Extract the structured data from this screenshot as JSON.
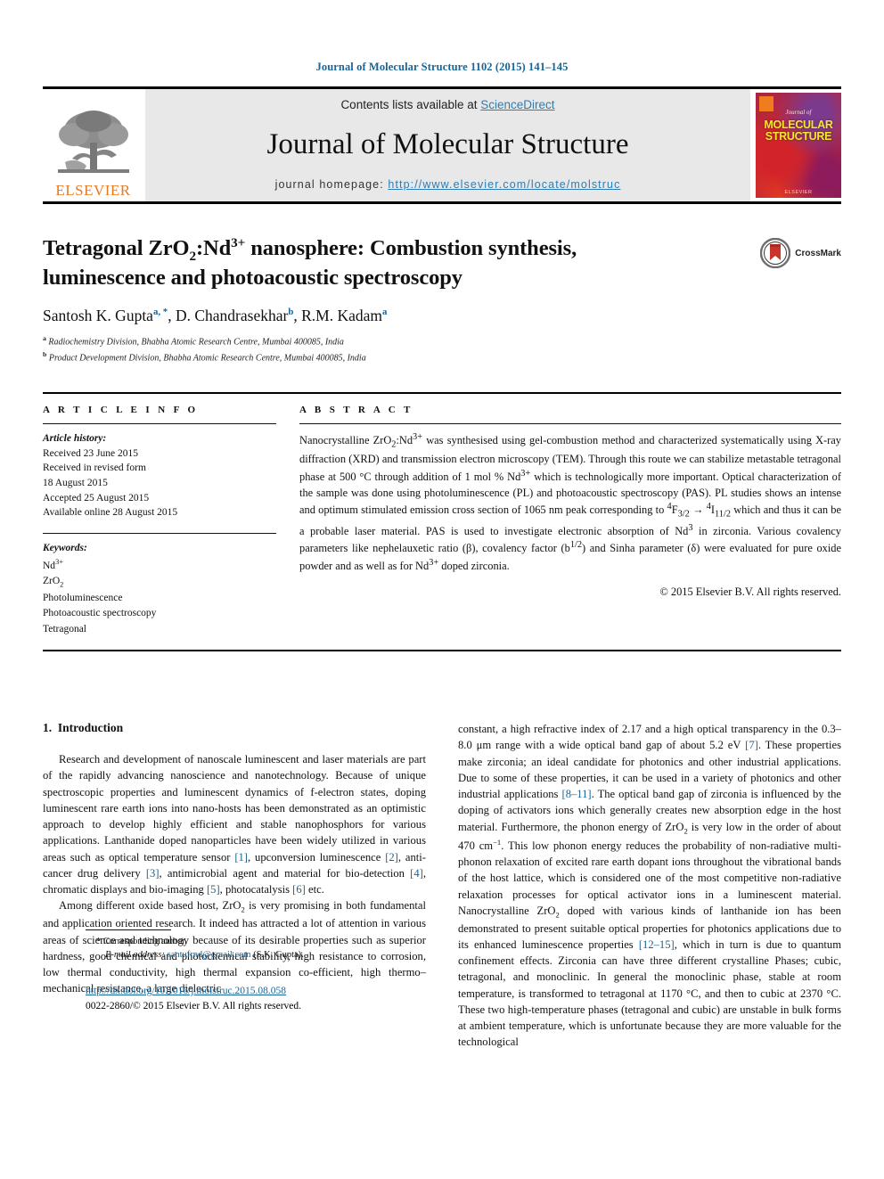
{
  "running_head": "Journal of Molecular Structure 1102 (2015) 141–145",
  "masthead": {
    "contents_prefix": "Contents lists available at ",
    "sciencedirect": "ScienceDirect",
    "journal_name": "Journal of Molecular Structure",
    "homepage_label": "journal homepage: ",
    "homepage_url": "http://www.elsevier.com/locate/molstruc",
    "publisher_wordmark": "ELSEVIER",
    "cover": {
      "kicker": "Journal of",
      "line1": "MOLECULAR",
      "line2": "STRUCTURE",
      "publisher": "ELSEVIER"
    },
    "colors": {
      "link": "#2E7DB3",
      "elsevier_orange": "#E87B1E",
      "band_background": "#e8e8e8"
    }
  },
  "article": {
    "title_line1_pre": "Tetragonal ZrO",
    "title_sub": "2",
    "title_line1_mid": ":Nd",
    "title_sup": "3+",
    "title_line1_post": " nanosphere: Combustion synthesis,",
    "title_line2": "luminescence and photoacoustic spectroscopy",
    "crossmark_label": "CrossMark",
    "authors_html": "Santosh K. Gupta, D. Chandrasekhar, R.M. Kadam",
    "affiliation_a": "Radiochemistry Division, Bhabha Atomic Research Centre, Mumbai 400085, India",
    "affiliation_b": "Product Development Division, Bhabha Atomic Research Centre, Mumbai 400085, India"
  },
  "article_info": {
    "heading": "A R T I C L E  I N F O",
    "history_label": "Article history:",
    "history": [
      "Received 23 June 2015",
      "Received in revised form",
      "18 August 2015",
      "Accepted 25 August 2015",
      "Available online 28 August 2015"
    ],
    "keywords_label": "Keywords:",
    "keywords": [
      "Nd3+",
      "ZrO2",
      "Photoluminescence",
      "Photoacoustic spectroscopy",
      "Tetragonal"
    ]
  },
  "abstract": {
    "heading": "A B S T R A C T",
    "body": "Nanocrystalline ZrO2:Nd3+ was synthesised using gel-combustion method and characterized systematically using X-ray diffraction (XRD) and transmission electron microscopy (TEM). Through this route we can stabilize metastable tetragonal phase at 500 °C through addition of 1 mol % Nd3+ which is technologically more important. Optical characterization of the sample was done using photoluminescence (PL) and photoacoustic spectroscopy (PAS). PL studies shows an intense and optimum stimulated emission cross section of 1065 nm peak corresponding to 4F3/2 → 4I11/2 which and thus it can be a probable laser material. PAS is used to investigate electronic absorption of Nd3 in zirconia. Various covalency parameters like nephelauxetic ratio (β), covalency factor (b1/2) and Sinha parameter (δ) were evaluated for pure oxide powder and as well as for Nd3+ doped zirconia.",
    "copyright": "© 2015 Elsevier B.V. All rights reserved."
  },
  "introduction": {
    "section_number": "1.",
    "section_title": "Introduction",
    "left_paragraphs": [
      "Research and development of nanoscale luminescent and laser materials are part of the rapidly advancing nanoscience and nanotechnology. Because of unique spectroscopic properties and luminescent dynamics of f-electron states, doping luminescent rare earth ions into nano-hosts has been demonstrated as an optimistic approach to develop highly efficient and stable nanophosphors for various applications. Lanthanide doped nanoparticles have been widely utilized in various areas such as optical temperature sensor [1], upconversion luminescence [2], anti-cancer drug delivery [3], antimicrobial agent and material for bio-detection [4], chromatic displays and bio-imaging [5], photocatalysis [6] etc.",
      "Among different oxide based host, ZrO2 is very promising in both fundamental and application oriented research. It indeed has attracted a lot of attention in various areas of science and technology because of its desirable properties such as superior hardness, good chemical and photochemical stability, high resistance to corrosion, low thermal conductivity, high thermal expansion co-efficient, high thermo–mechanical resistance, a large dielectric"
    ],
    "right_paragraphs": [
      "constant, a high refractive index of 2.17 and a high optical transparency in the 0.3–8.0 μm range with a wide optical band gap of about 5.2 eV [7]. These properties make zirconia; an ideal candidate for photonics and other industrial applications. Due to some of these properties, it can be used in a variety of photonics and other industrial applications [8–11]. The optical band gap of zirconia is influenced by the doping of activators ions which generally creates new absorption edge in the host material. Furthermore, the phonon energy of ZrO2 is very low in the order of about 470 cm−1. This low phonon energy reduces the probability of non-radiative multi-phonon relaxation of excited rare earth dopant ions throughout the vibrational bands of the host lattice, which is considered one of the most competitive non-radiative relaxation processes for optical activator ions in a luminescent material. Nanocrystalline ZrO2 doped with various kinds of lanthanide ion has been demonstrated to present suitable optical properties for photonics applications due to its enhanced luminescence properties [12–15], which in turn is due to quantum confinement effects. Zirconia can have three different crystalline Phases; cubic, tetragonal, and monoclinic. In general the monoclinic phase, stable at room temperature, is transformed to tetragonal at 1170 °C, and then to cubic at 2370 °C. These two high-temperature phases (tetragonal and cubic) are unstable in bulk forms at ambient temperature, which is unfortunate because they are more valuable for the technological"
    ]
  },
  "footnotes": {
    "corresponding_marker": "*",
    "corresponding_text": "Corresponding author.",
    "email_label": "E-mail address:",
    "email": "santufrnd@gmail.com",
    "email_owner": "(S.K. Gupta).",
    "doi_url": "http://dx.doi.org/10.1016/j.molstruc.2015.08.058",
    "issn_line": "0022-2860/© 2015 Elsevier B.V. All rights reserved."
  }
}
